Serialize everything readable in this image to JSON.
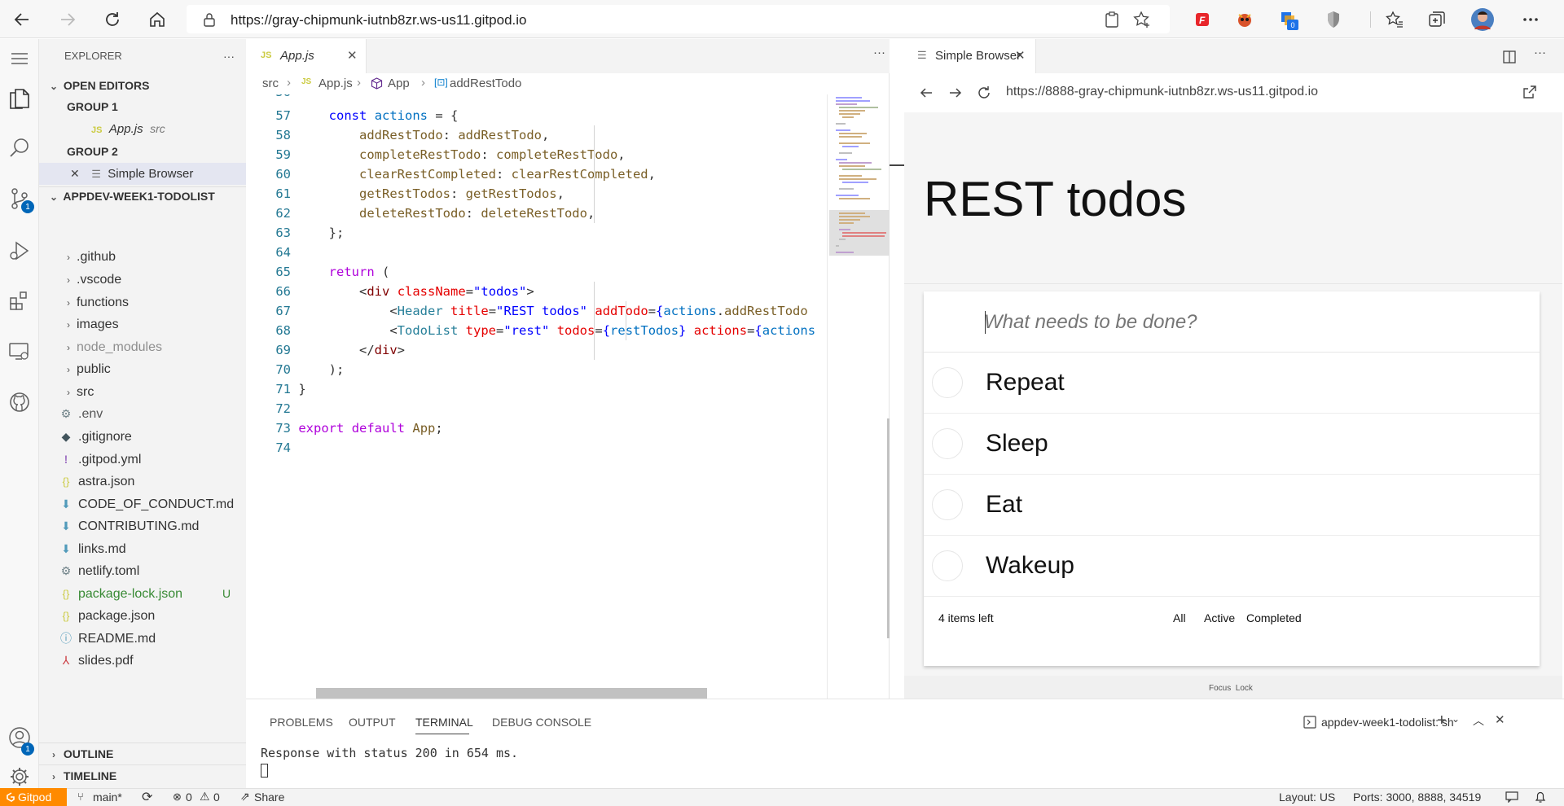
{
  "browser": {
    "url": "https://gray-chipmunk-iutnb8zr.ws-us11.gitpod.io",
    "ext_badge": "0"
  },
  "activity": {
    "scm_badge": "1",
    "account_badge": "1"
  },
  "sidebar": {
    "title": "EXPLORER",
    "more": "···",
    "open_editors": "OPEN EDITORS",
    "group1": "GROUP 1",
    "group1_file": "App.js",
    "group1_path": "src",
    "group2": "GROUP 2",
    "group2_file": "Simple Browser",
    "project": "APPDEV-WEEK1-TODOLIST",
    "folders": [
      ".github",
      ".vscode",
      "functions",
      "images",
      "node_modules",
      "public",
      "src"
    ],
    "files": [
      ".env",
      ".gitignore",
      ".gitpod.yml",
      "astra.json",
      "CODE_OF_CONDUCT.md",
      "CONTRIBUTING.md",
      "links.md",
      "netlify.toml",
      "package-lock.json",
      "package.json",
      "README.md",
      "slides.pdf"
    ],
    "untracked_badge": "U",
    "outline": "OUTLINE",
    "timeline": "TIMELINE"
  },
  "editor": {
    "tab_label": "App.js",
    "tab_icon": "JS",
    "crumbs": [
      "src",
      "App.js",
      "App",
      "addRestTodo"
    ],
    "partial_line_number": "56",
    "line_numbers": [
      "57",
      "58",
      "59",
      "60",
      "61",
      "62",
      "63",
      "64",
      "65",
      "66",
      "67",
      "68",
      "69",
      "70",
      "71",
      "72",
      "73",
      "74"
    ]
  },
  "simple_browser": {
    "tab_label": "Simple Browser",
    "url": "https://8888-gray-chipmunk-iutnb8zr.ws-us11.gitpod.io",
    "page_title": "REST todos",
    "new_todo_placeholder": "What needs to be done?",
    "todos": [
      "Repeat",
      "Sleep",
      "Eat",
      "Wakeup"
    ],
    "items_left": "4 items left",
    "filters": [
      "All",
      "Active",
      "Completed"
    ],
    "focus_lock": "Focus  Lock"
  },
  "panel": {
    "tabs": [
      "PROBLEMS",
      "OUTPUT",
      "TERMINAL",
      "DEBUG CONSOLE"
    ],
    "active_tab": "TERMINAL",
    "terminal_name": "appdev-week1-todolist: sh",
    "terminal_output": "Response with status 200 in 654 ms."
  },
  "status": {
    "gitpod": "Gitpod",
    "branch": "main*",
    "errors": "0",
    "warnings": "0",
    "share": "Share",
    "layout": "Layout: US",
    "ports": "Ports: 3000, 8888, 34519"
  },
  "colors": {
    "accent": "#0066b8",
    "gitpod_orange": "#ff8a00",
    "active_tab_underline": "#424242"
  }
}
